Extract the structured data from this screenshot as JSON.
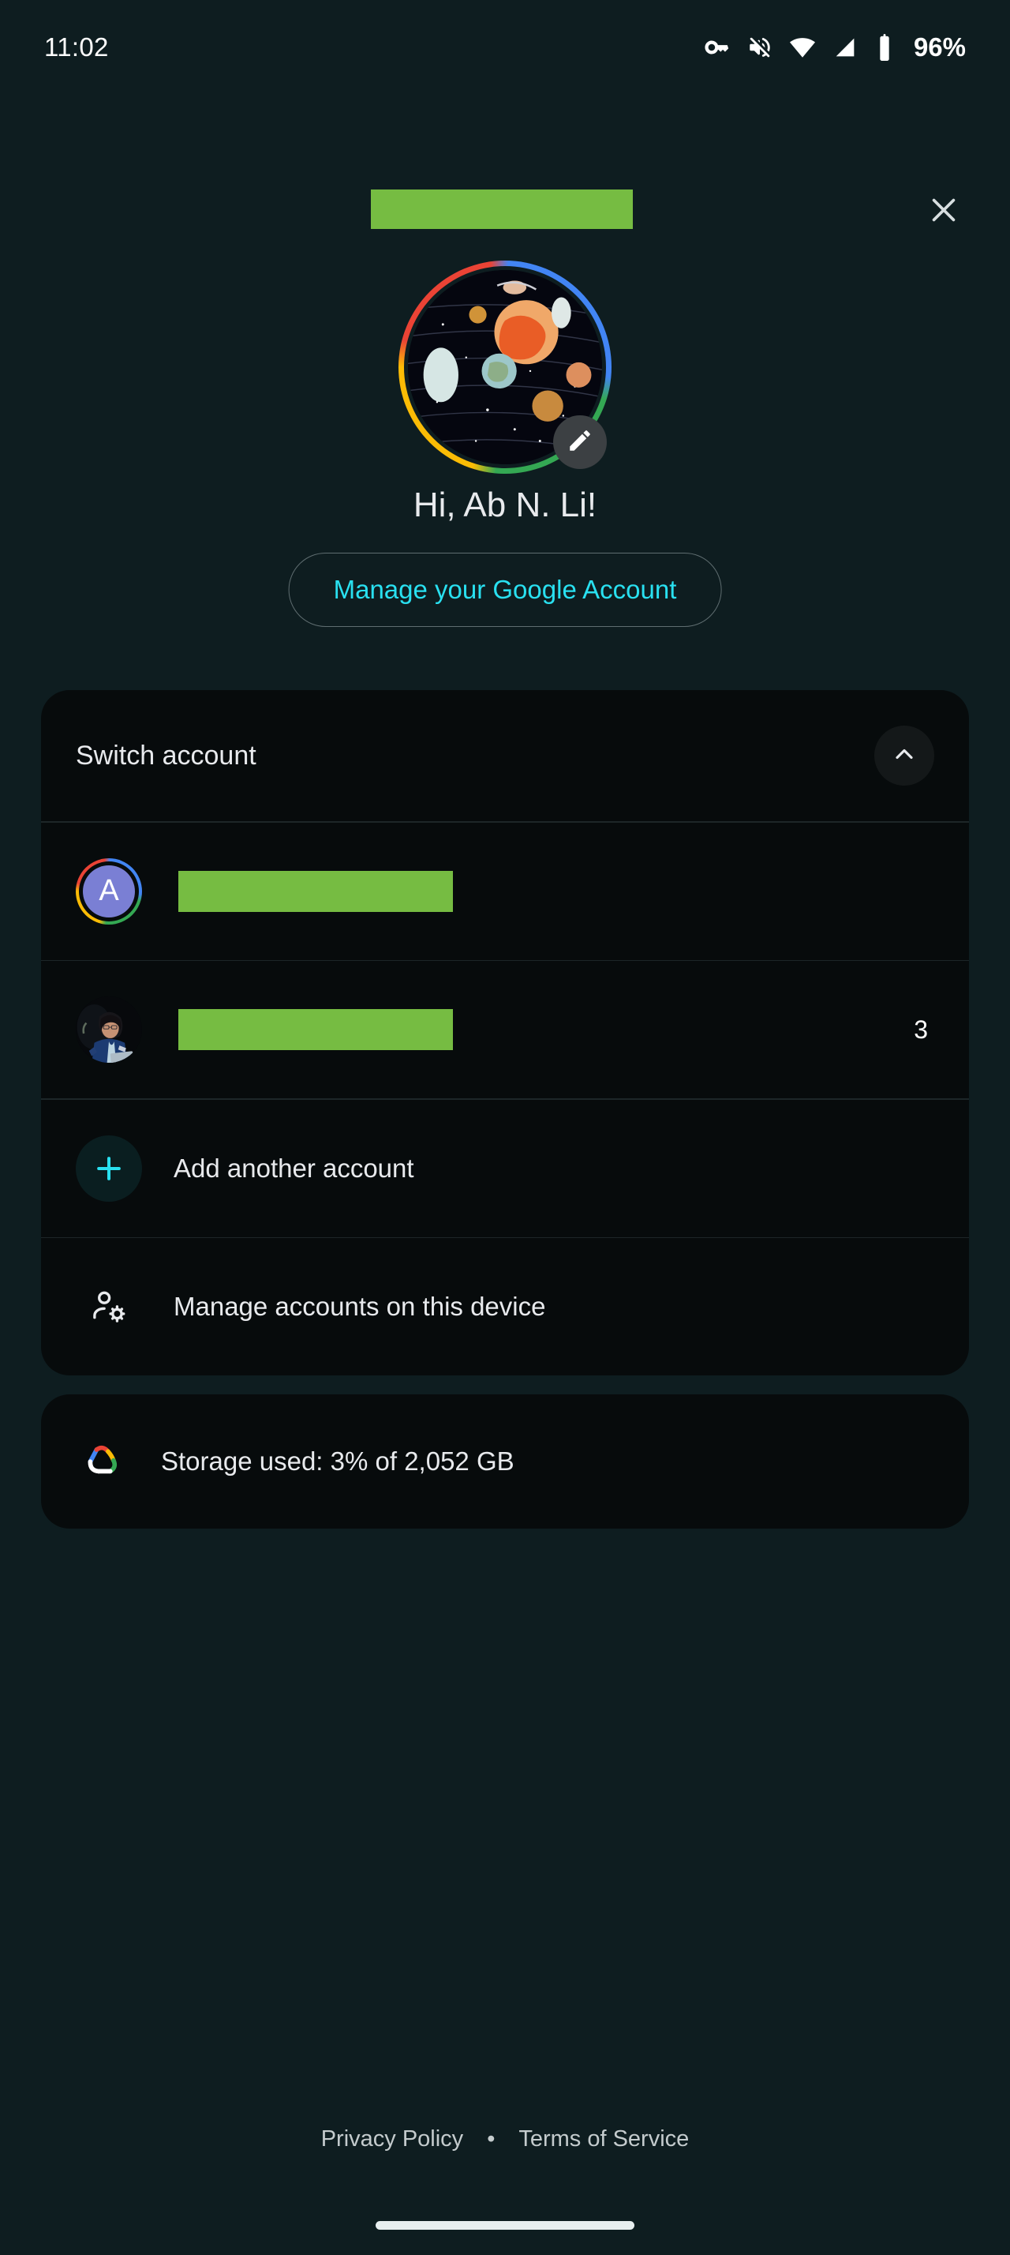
{
  "status_bar": {
    "time": "11:02",
    "battery_percent": "96%",
    "icons": [
      "vpn-key-icon",
      "volume-muted-icon",
      "wifi-icon",
      "cellular-signal-icon",
      "battery-icon"
    ]
  },
  "header": {
    "title_redacted": "",
    "close_label": "Close",
    "close_icon": "close-icon"
  },
  "profile": {
    "avatar_icon": "space-planets-avatar",
    "avatar_edit_icon": "pencil-edit-icon",
    "greeting": "Hi, Ab N. Li!",
    "manage_account_label": "Manage your Google Account"
  },
  "switch_account": {
    "header_label": "Switch account",
    "collapse_icon": "chevron-up-icon",
    "accounts": [
      {
        "avatar_type": "initial",
        "initial": "A",
        "name_redacted": "",
        "active": true,
        "count": ""
      },
      {
        "avatar_type": "photo",
        "initial": "",
        "name_redacted": "",
        "active": false,
        "count": "3"
      }
    ],
    "menu_items": [
      {
        "label": "Add another account",
        "icon": "plus-icon"
      },
      {
        "label": "Manage accounts on this device",
        "icon": "manage-accounts-icon"
      }
    ]
  },
  "storage": {
    "icon": "google-one-cloud-icon",
    "label": "Storage used: 3% of 2,052 GB"
  },
  "footer": {
    "privacy_label": "Privacy Policy",
    "separator": "•",
    "terms_label": "Terms of Service"
  },
  "navigation": {
    "home_pill": "home-gesture-pill"
  },
  "colors": {
    "background": "#0e1d20",
    "card": "#070b0c",
    "accent_cyan": "#29e0f0",
    "redaction_green": "#76bc42",
    "text_primary": "#e8eaed",
    "text_secondary": "#c4cbcd"
  }
}
